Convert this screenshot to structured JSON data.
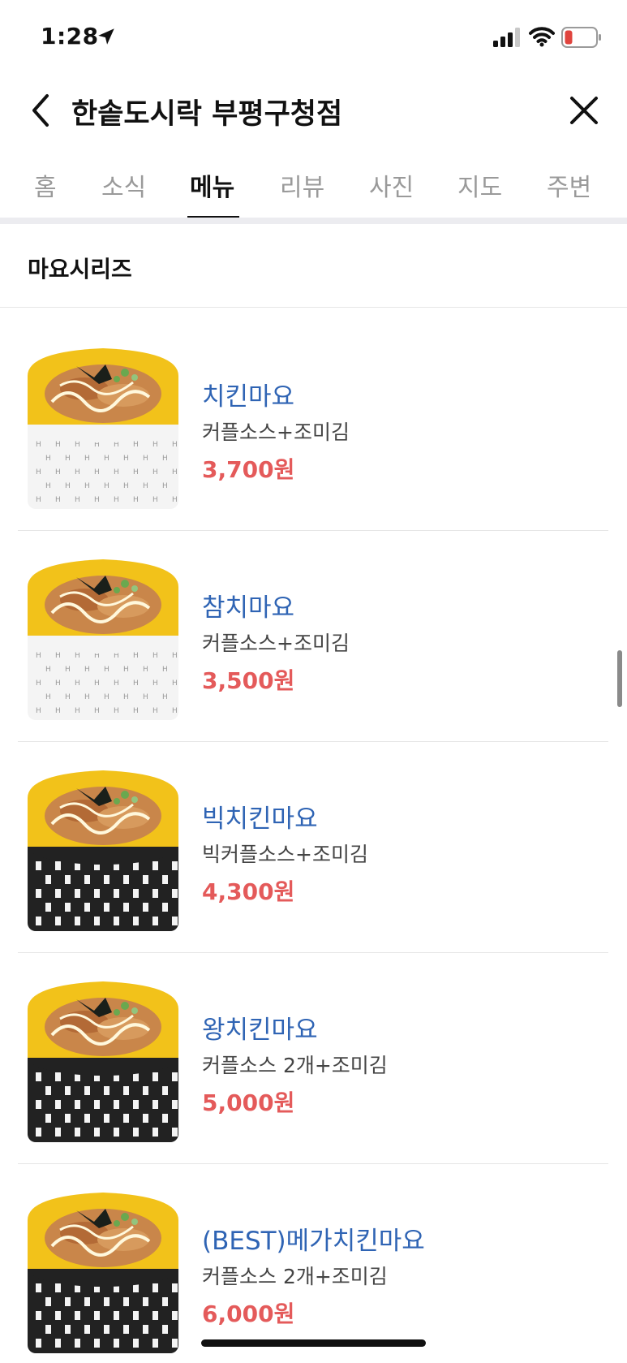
{
  "status_bar": {
    "time": "1:28",
    "icons": [
      "location-arrow-icon",
      "cellular-signal-icon",
      "wifi-icon",
      "battery-low-icon"
    ],
    "battery_color": "#e0443e"
  },
  "header": {
    "title": "한솥도시락 부평구청점",
    "back_icon": "chevron-left-icon",
    "close_icon": "close-icon"
  },
  "tabs": [
    {
      "label": "홈",
      "active": false
    },
    {
      "label": "소식",
      "active": false
    },
    {
      "label": "메뉴",
      "active": true
    },
    {
      "label": "리뷰",
      "active": false
    },
    {
      "label": "사진",
      "active": false
    },
    {
      "label": "지도",
      "active": false
    },
    {
      "label": "주변",
      "active": false
    }
  ],
  "section": {
    "title": "마요시리즈"
  },
  "menu_items": [
    {
      "name": "치킨마요",
      "desc": "커플소스+조미김",
      "price": "3,700원",
      "bowl": "white"
    },
    {
      "name": "참치마요",
      "desc": "커플소스+조미김",
      "price": "3,500원",
      "bowl": "white"
    },
    {
      "name": "빅치킨마요",
      "desc": "빅커플소스+조미김",
      "price": "4,300원",
      "bowl": "black"
    },
    {
      "name": "왕치킨마요",
      "desc": "커플소스 2개+조미김",
      "price": "5,000원",
      "bowl": "black"
    },
    {
      "name": "(BEST)메가치킨마요",
      "desc": "커플소스 2개+조미김",
      "price": "6,000원",
      "bowl": "black"
    }
  ],
  "colors": {
    "item_name": "#2f64b4",
    "price": "#e45a5a",
    "active_tab": "#111111",
    "inactive_tab": "#9a9a9a"
  }
}
